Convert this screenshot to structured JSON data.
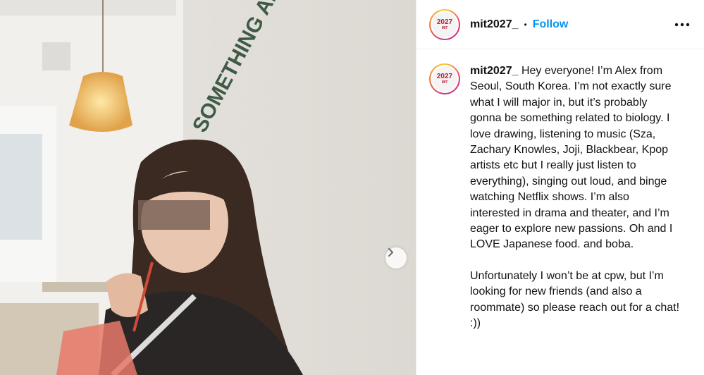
{
  "post": {
    "username": "mit2027_",
    "separator": "•",
    "follow_label": "Follow",
    "more_icon": "more-horizontal-icon",
    "avatar": {
      "line1": "2027",
      "line2": "MIT"
    },
    "caption_user": "mit2027_",
    "caption_para1": "Hey everyone! I’m Alex from Seoul, South Korea. I’m not exactly sure what I will major in, but it’s probably gonna be something related to biology. I love drawing, listening to music (Sza, Zachary Knowles, Joji, Blackbear, Kpop artists etc but I really just listen to everything), singing out loud, and binge watching Netflix shows. I’m also interested in drama and theater, and I’m eager to explore new passions. Oh and I LOVE Japanese food. and boba.",
    "caption_para2": "Unfortunately I won’t be at cpw, but I’m looking for new friends (and also a roommate) so please reach out for a chat! :))"
  },
  "photo": {
    "wall_sign": "SOMETHING ABOUT",
    "next_icon": "chevron-right-icon",
    "colors": {
      "wall": "#ece9e4",
      "sign": "#3f5b46",
      "hair": "#3a2a22",
      "jacket": "#2a2626"
    }
  }
}
